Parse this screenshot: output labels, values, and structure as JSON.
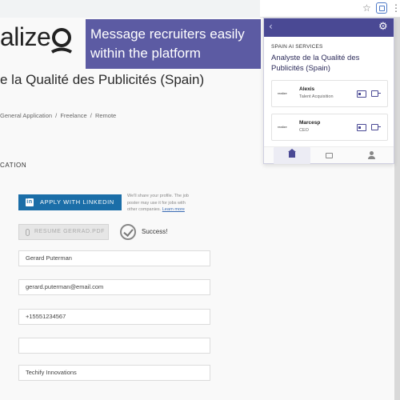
{
  "browser": {
    "bookmark_icon": "star-icon",
    "extension_icon": "extension-icon",
    "menu_icon": "kebab-menu-icon"
  },
  "site": {
    "logo_text": "alize",
    "banner_text": "Message recruiters easily within the platform"
  },
  "job": {
    "title": "e la Qualité des Publicités (Spain)",
    "breadcrumbs": [
      "General Application",
      "/",
      "Freelance",
      "/",
      "Remote"
    ],
    "section_heading": "CATION"
  },
  "application": {
    "linkedin_label": "APPLY WITH LINKEDIN",
    "linkedin_note": "We'll share your profile. The job poster may use it for jobs with other companies.",
    "linkedin_link": "Learn more",
    "resume_label": "RESUME GERRAD.PDF",
    "success_text": "Success!",
    "fields": [
      {
        "name": "full-name-field",
        "value": "Gerard Puterman"
      },
      {
        "name": "email-field",
        "value": "gerard.puterman@email.com"
      },
      {
        "name": "phone-field",
        "value": "+15551234567"
      },
      {
        "name": "empty-field",
        "value": ""
      },
      {
        "name": "current-company-field",
        "value": "Techify Innovations"
      }
    ]
  },
  "extension": {
    "company": "SPAIN AI SERVICES",
    "job_title": "Analyste de la Qualité des Publicités (Spain)",
    "contacts": [
      {
        "name": "Alexis",
        "role": "Talent Acquisition",
        "logo": "realize"
      },
      {
        "name": "Marcesp",
        "role": "CEO",
        "logo": "realize"
      }
    ],
    "nav": [
      "home-icon",
      "document-icon",
      "user-icon"
    ]
  }
}
